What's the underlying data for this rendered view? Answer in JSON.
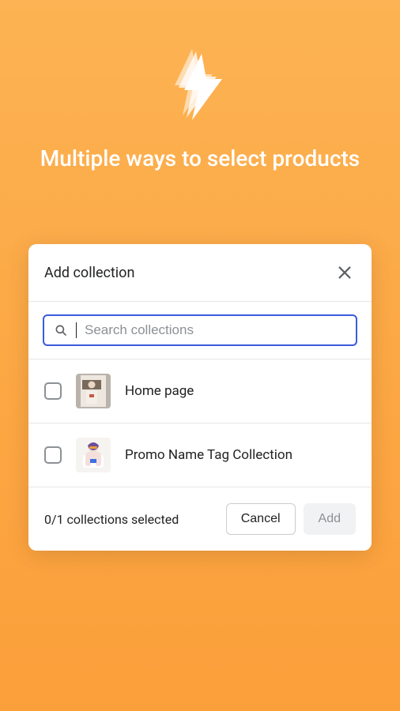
{
  "hero": {
    "title": "Multiple ways to select products"
  },
  "modal": {
    "title": "Add collection",
    "search": {
      "placeholder": "Search collections",
      "value": ""
    },
    "items": [
      {
        "label": "Home page"
      },
      {
        "label": "Promo Name Tag Collection"
      }
    ],
    "footer": {
      "status": "0/1 collections selected",
      "cancel_label": "Cancel",
      "add_label": "Add"
    }
  }
}
